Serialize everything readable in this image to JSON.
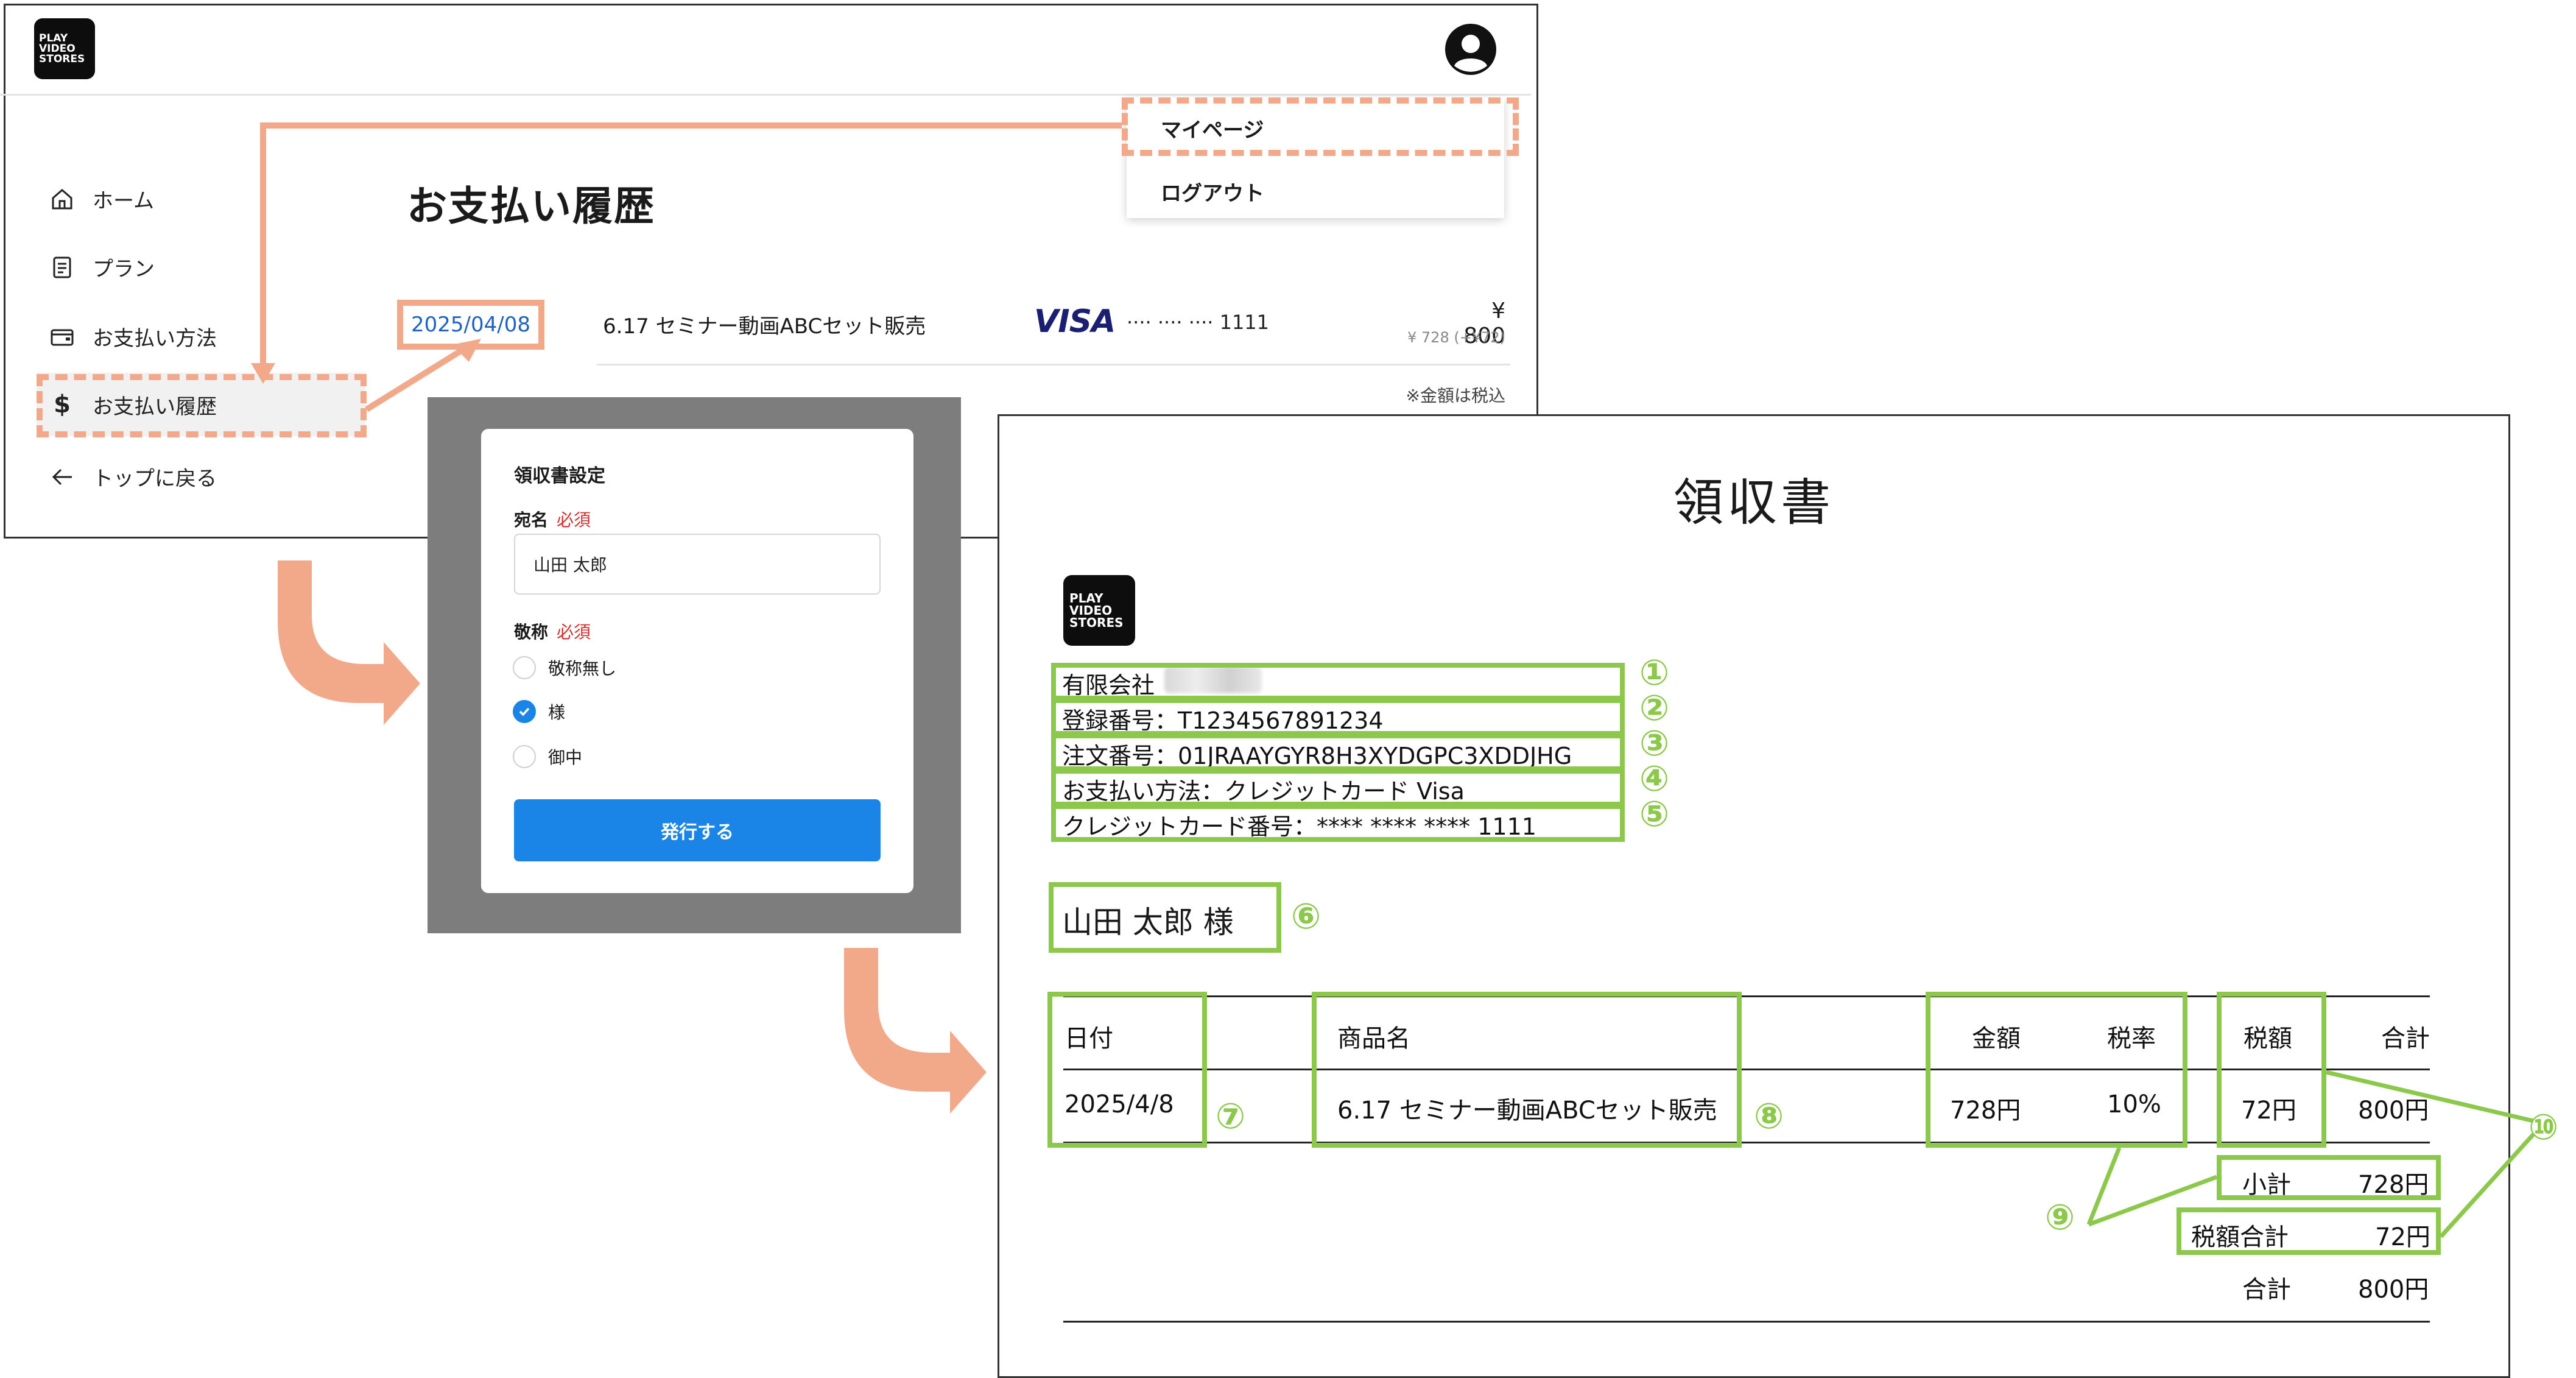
{
  "header": {
    "logo_text": [
      "PLAY",
      "VIDEO",
      "STORES"
    ],
    "user_menu": {
      "mypage": "マイページ",
      "logout": "ログアウト"
    }
  },
  "sidebar": {
    "items": [
      {
        "label": "ホーム",
        "icon": "home-icon"
      },
      {
        "label": "プラン",
        "icon": "document-icon"
      },
      {
        "label": "お支払い方法",
        "icon": "wallet-icon"
      },
      {
        "label": "お支払い履歴",
        "icon": "dollar-icon"
      },
      {
        "label": "トップに戻る",
        "icon": "arrow-left-icon"
      }
    ]
  },
  "history": {
    "title": "お支払い履歴",
    "row": {
      "date": "2025/04/08",
      "item": "6.17 セミナー動画ABCセット販売",
      "card_brand": "VISA",
      "card_number": "···· ···· ···· 1111",
      "amount": "¥ 800",
      "amount_detail": "¥ 728 (+¥72)"
    },
    "tax_note": "※金額は税込"
  },
  "modal": {
    "title": "領収書設定",
    "name_label": "宛名",
    "required": "必須",
    "name_value": "山田 太郎",
    "honorific_label": "敬称",
    "honorific_options": [
      "敬称無し",
      "様",
      "御中"
    ],
    "selected_option": "様",
    "issue_button": "発行する"
  },
  "receipt": {
    "title": "領収書",
    "company": "有限会社",
    "registration": "登録番号：T1234567891234",
    "order": "注文番号：01JRAAYGYR8H3XYDGPC3XDDJHG",
    "method": "お支払い方法：クレジットカード Visa",
    "card": "クレジットカード番号：**** **** **** 1111",
    "recipient": "山田 太郎 様",
    "columns": [
      "日付",
      "商品名",
      "金額",
      "税率",
      "税額",
      "合計"
    ],
    "row": [
      "2025/4/8",
      "6.17 セミナー動画ABCセット販売",
      "728円",
      "10%",
      "72円",
      "800円"
    ],
    "subtotal_label": "小計",
    "subtotal_value": "728円",
    "tax_total_label": "税額合計",
    "tax_total_value": "72円",
    "grand_total_label": "合計",
    "grand_total_value": "800円"
  },
  "annotations": [
    "①",
    "②",
    "③",
    "④",
    "⑤",
    "⑥",
    "⑦",
    "⑧",
    "⑨",
    "⑩"
  ],
  "colors": {
    "highlight_orange": "#f2a98a",
    "annotation_green": "#8cc84b",
    "primary_blue": "#1a85e6",
    "link_blue": "#1f62c1"
  }
}
